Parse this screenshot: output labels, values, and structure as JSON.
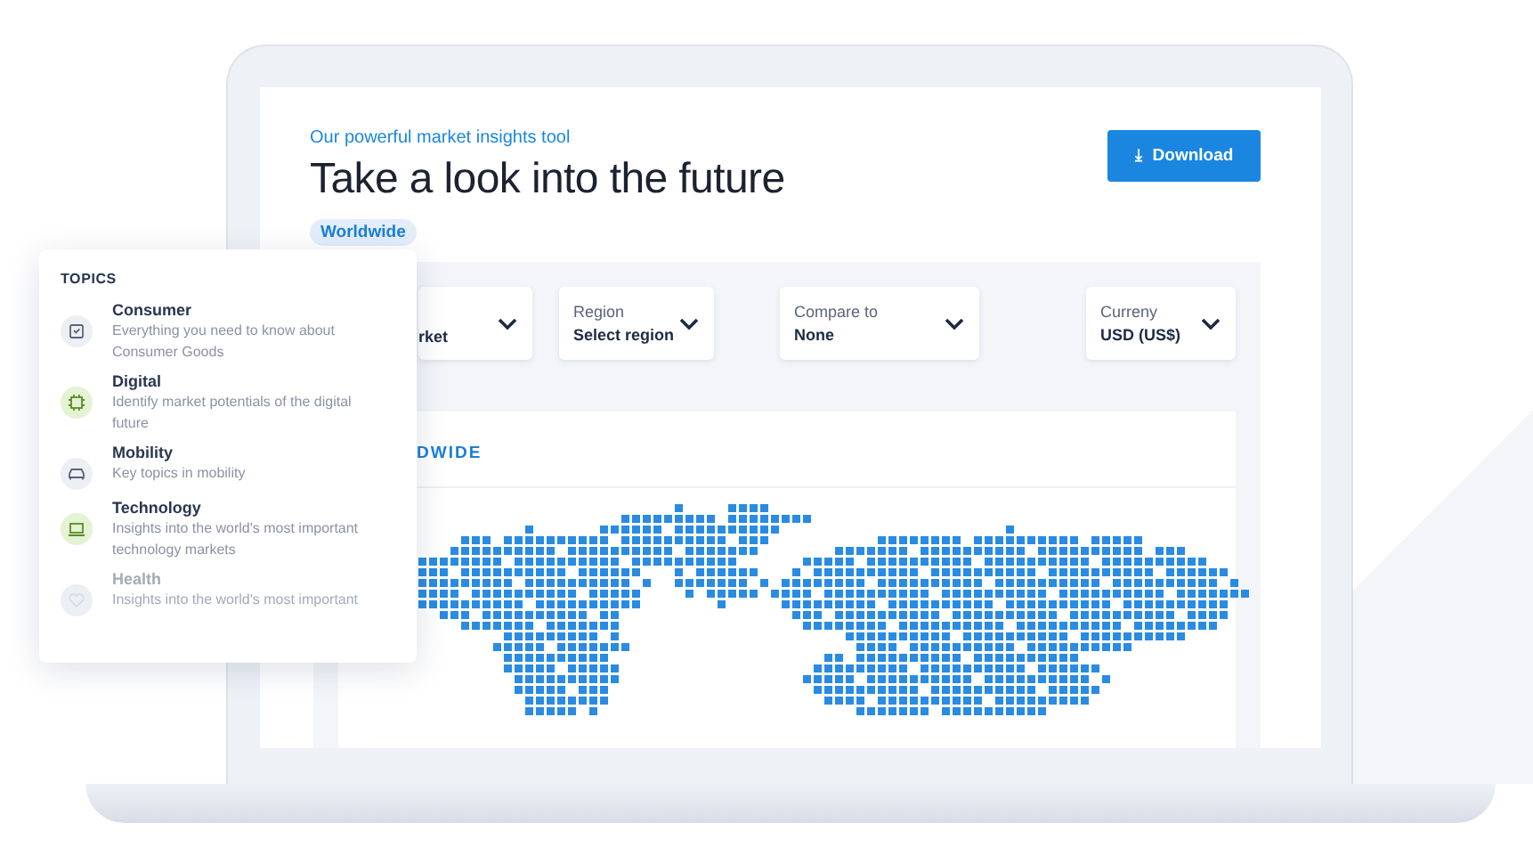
{
  "header": {
    "subtitle": "Our powerful market insights tool",
    "title": "Take a look into the future",
    "tag": "Worldwide",
    "download_button": {
      "icon": "⤓",
      "label": "Download"
    }
  },
  "filters": [
    {
      "value": "rket"
    },
    {
      "label": "Region",
      "value": "Select region"
    },
    {
      "label": "Compare to",
      "value": "None"
    },
    {
      "label": "Curreny",
      "value": "USD (US$)"
    }
  ],
  "map_card": {
    "heading": "DWIDE"
  },
  "topics_panel": {
    "title": "TOPICS",
    "items": [
      {
        "kind": "consumer",
        "title": "Consumer",
        "description": "Everything you need to know about Consumer Goods",
        "faded": false
      },
      {
        "kind": "digital",
        "title": "Digital",
        "description": "Identify market potentials of the digital future",
        "faded": false
      },
      {
        "kind": "mobility",
        "title": "Mobility",
        "description": "Key topics in mobility",
        "faded": false
      },
      {
        "kind": "technology",
        "title": "Technology",
        "description": "Insights into the world's most important technology markets",
        "faded": false
      },
      {
        "kind": "health",
        "title": "Health",
        "description": "Insights into the world's most important",
        "faded": true
      }
    ]
  }
}
